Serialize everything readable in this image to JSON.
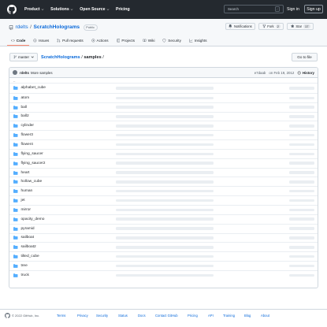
{
  "header": {
    "nav": [
      "Product",
      "Solutions",
      "Open Source",
      "Pricing"
    ],
    "search_placeholder": "Search",
    "search_shortcut": "/",
    "sign_in": "Sign in",
    "sign_up": "Sign up"
  },
  "repo": {
    "owner": "rdelts",
    "separator": "/",
    "name": "ScratchHolograms",
    "visibility": "Public",
    "notifications_label": "Notifications",
    "fork_label": "Fork",
    "fork_count": "2",
    "star_label": "Star",
    "star_count": "17"
  },
  "tabs": [
    {
      "label": "Code",
      "icon": "code-icon"
    },
    {
      "label": "Issues",
      "icon": "issue-icon"
    },
    {
      "label": "Pull requests",
      "icon": "pull-request-icon"
    },
    {
      "label": "Actions",
      "icon": "play-icon"
    },
    {
      "label": "Projects",
      "icon": "table-icon"
    },
    {
      "label": "Wiki",
      "icon": "book-icon"
    },
    {
      "label": "Security",
      "icon": "shield-icon"
    },
    {
      "label": "Insights",
      "icon": "graph-icon"
    }
  ],
  "file_nav": {
    "branch": "master",
    "crumb_repo": "ScratchHolograms",
    "crumb_sep": "/",
    "crumb_dir": "samples",
    "crumb_trail": "/",
    "go_to_file": "Go to file"
  },
  "commit": {
    "author": "rdelts",
    "message": "More samples",
    "sha": "e7daab",
    "date": "on Feb 19, 2012",
    "history_label": "History"
  },
  "parent_dir": "..",
  "files": [
    "alphabet_cube",
    "atom",
    "ball",
    "ball2",
    "cylinder",
    "flower3",
    "flower4",
    "flying_saucer",
    "flying_saucer2",
    "heart",
    "hollow_cube",
    "human",
    "jet",
    "mirror",
    "opacity_demo",
    "pyramid",
    "sailboat",
    "sailboat2",
    "tilted_cube",
    "tree",
    "truck"
  ],
  "footer": {
    "copyright": "© 2022 GitHub, Inc.",
    "links": [
      "Terms",
      "Privacy",
      "Security",
      "Status",
      "Docs",
      "Contact GitHub",
      "Pricing",
      "API",
      "Training",
      "Blog",
      "About"
    ]
  },
  "colors": {
    "header_bg": "#24292f",
    "link": "#0969da",
    "active_tab_underline": "#fd8c73",
    "folder": "#54aeff"
  }
}
